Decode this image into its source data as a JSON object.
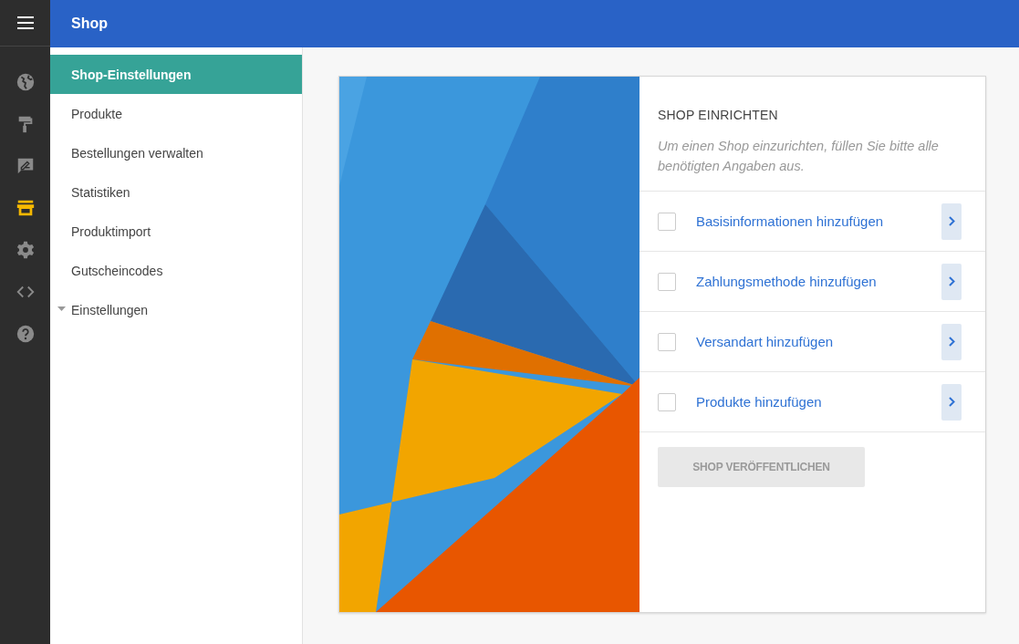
{
  "app_bar": {
    "title": "Shop"
  },
  "rail": [
    {
      "kind": "globe",
      "selected": false
    },
    {
      "kind": "roller",
      "selected": false
    },
    {
      "kind": "feedback",
      "selected": false
    },
    {
      "kind": "store",
      "selected": true
    },
    {
      "kind": "gear",
      "selected": false
    },
    {
      "kind": "code",
      "selected": false
    },
    {
      "kind": "help",
      "selected": false
    }
  ],
  "sidebar": {
    "items": [
      {
        "label": "Shop-Einstellungen",
        "kind": "link",
        "selected": true
      },
      {
        "label": "Produkte",
        "kind": "link",
        "selected": false
      },
      {
        "label": "Bestellungen verwalten",
        "kind": "link",
        "selected": false
      },
      {
        "label": "Statistiken",
        "kind": "link",
        "selected": false
      },
      {
        "label": "Produktimport",
        "kind": "link",
        "selected": false
      },
      {
        "label": "Gutscheincodes",
        "kind": "link",
        "selected": false
      },
      {
        "label": "Einstellungen",
        "kind": "group",
        "selected": false
      }
    ]
  },
  "setup_card": {
    "title": "SHOP EINRICHTEN",
    "description": "Um einen Shop einzurichten, füllen Sie bitte alle benötigten Angaben aus.",
    "tasks": [
      {
        "label": "Basisinformationen hinzufügen",
        "checked": false
      },
      {
        "label": "Zahlungsmethode hinzufügen",
        "checked": false
      },
      {
        "label": "Versandart hinzufügen",
        "checked": false
      },
      {
        "label": "Produkte hinzufügen",
        "checked": false
      }
    ],
    "publish_button": {
      "label": "SHOP VERÖFFENTLICHEN",
      "disabled": true
    }
  }
}
